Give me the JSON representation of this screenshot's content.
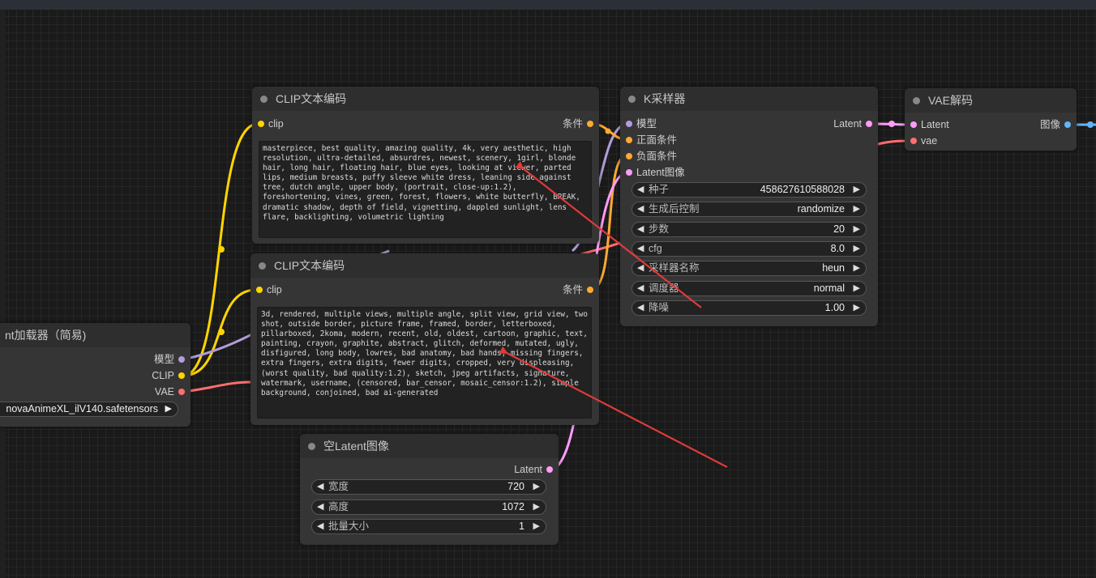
{
  "nodes": {
    "clip_pos": {
      "title": "CLIP文本编码",
      "input": "clip",
      "output": "条件",
      "text": "masterpiece, best quality, amazing quality, 4k, very aesthetic, high resolution, ultra-detailed, absurdres, newest, scenery, 1girl, blonde hair, long hair, floating hair, blue eyes, looking at viewer, parted lips, medium breasts, puffy sleeve white dress, leaning side against tree, dutch angle, upper body, (portrait, close-up:1.2), foreshortening, vines, green, forest, flowers, white butterfly, BREAK, dramatic shadow, depth of field, vignetting, dappled sunlight, lens flare, backlighting, volumetric lighting"
    },
    "clip_neg": {
      "title": "CLIP文本编码",
      "input": "clip",
      "output": "条件",
      "text": "3d, rendered, multiple views, multiple angle, split view, grid view, two shot, outside border, picture frame, framed, border, letterboxed, pillarboxed, 2koma, modern, recent, old, oldest, cartoon, graphic, text, painting, crayon, graphite, abstract, glitch, deformed, mutated, ugly, disfigured, long body, lowres, bad anatomy, bad hands, missing fingers, extra fingers, extra digits, fewer digits, cropped, very displeasing, (worst quality, bad quality:1.2), sketch, jpeg artifacts, signature, watermark, username, (censored, bar_censor, mosaic_censor:1.2), simple background, conjoined, bad ai-generated"
    },
    "ksampler": {
      "title": "K采样器",
      "inputs": [
        "模型",
        "正面条件",
        "负面条件",
        "Latent图像"
      ],
      "output": "Latent",
      "widgets": [
        {
          "label": "种子",
          "value": "458627610588028"
        },
        {
          "label": "生成后控制",
          "value": "randomize"
        },
        {
          "label": "步数",
          "value": "20"
        },
        {
          "label": "cfg",
          "value": "8.0"
        },
        {
          "label": "采样器名称",
          "value": "heun"
        },
        {
          "label": "调度器",
          "value": "normal"
        },
        {
          "label": "降噪",
          "value": "1.00"
        }
      ]
    },
    "vae_decode": {
      "title": "VAE解码",
      "inputs": [
        "Latent",
        "vae"
      ],
      "output": "图像"
    },
    "checkpoint": {
      "title": "nt加载器（简易)",
      "outputs": [
        "模型",
        "CLIP",
        "VAE"
      ],
      "ckpt_value": "novaAnimeXL_ilV140.safetensors"
    },
    "empty_latent": {
      "title": "空Latent图像",
      "output": "Latent",
      "widgets": [
        {
          "label": "宽度",
          "value": "720"
        },
        {
          "label": "高度",
          "value": "1072"
        },
        {
          "label": "批量大小",
          "value": "1"
        }
      ]
    }
  },
  "colors": {
    "clip": "#ffd500",
    "conditioning": "#ffa931",
    "model": "#b39ddb",
    "latent": "#ff9cf9",
    "vae": "#ff6e6e",
    "image": "#64b5f6",
    "annotation_arrow": "#e03a3a"
  },
  "icons": {
    "arrow_left": "◀",
    "arrow_right": "▶"
  }
}
